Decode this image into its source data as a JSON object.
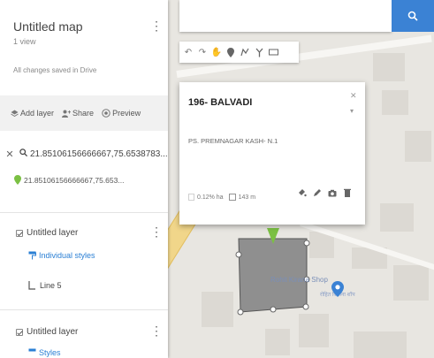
{
  "map_title": "Untitled map",
  "views": "1 view",
  "save_status": "All changes saved in Drive",
  "actions": [
    {
      "label": "Add layer",
      "icon": "add-layer-icon"
    },
    {
      "label": "Share",
      "icon": "share-icon"
    },
    {
      "label": "Preview",
      "icon": "preview-icon"
    }
  ],
  "search": {
    "query": "21.85106156666667,75.6538783...",
    "result": "21.85106156666667,75.653..."
  },
  "layers": [
    {
      "name": "Untitled layer",
      "styles_label": "Individual styles",
      "item": "Line 5"
    },
    {
      "name": "Untitled layer",
      "styles_label": "Styles"
    }
  ],
  "card": {
    "title": "196- BALVADI",
    "description": "PS. PREMNAGAR KASH- N.1",
    "area": "0.12% ha",
    "perimeter": "143 m"
  },
  "map": {
    "shop_name": "Rohit Kirana Shop",
    "shop_sub": "रोहित किराना शॉप"
  },
  "colors": {
    "accent": "#3b82d4",
    "marker": "#7bc043",
    "road": "#f1d68a",
    "polygon_fill": "#8a8a8a"
  }
}
